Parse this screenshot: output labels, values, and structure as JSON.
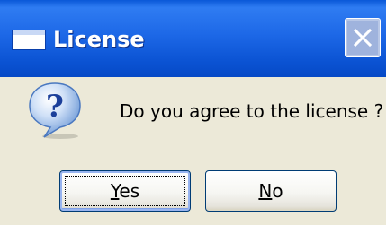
{
  "window": {
    "title": "License",
    "title_icon": "window-icon",
    "close_icon": "close-icon",
    "colors": {
      "titlebar": "#0b53d3",
      "body": "#ece9d8",
      "close_button": "#9fb3dd",
      "default_button_border": "#003c74"
    }
  },
  "dialog": {
    "icon": "question-icon",
    "message": "Do you agree to the license ?"
  },
  "buttons": {
    "yes_label": "Yes",
    "no_label": "No"
  }
}
